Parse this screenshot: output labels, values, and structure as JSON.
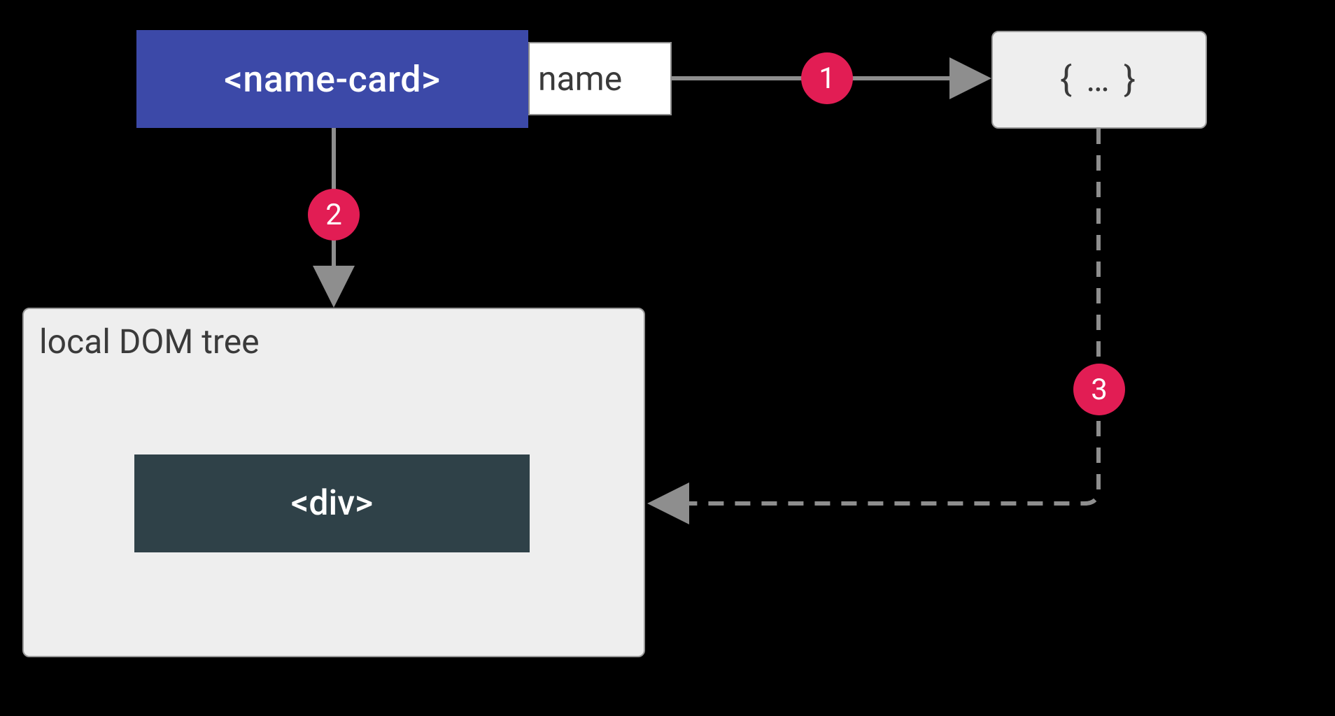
{
  "diagram": {
    "name_card_label": "<name-card>",
    "name_tag_label": "name",
    "data_object_label": "{  …  }",
    "dom_tree_label": "local DOM tree",
    "div_label": "<div>",
    "markers": {
      "m1": "1",
      "m2": "2",
      "m3": "3"
    },
    "colors": {
      "name_card_bg": "#3c49a8",
      "marker_bg": "#e21d54",
      "div_bg": "#2f4148",
      "panel_bg": "#eeeeee"
    }
  }
}
